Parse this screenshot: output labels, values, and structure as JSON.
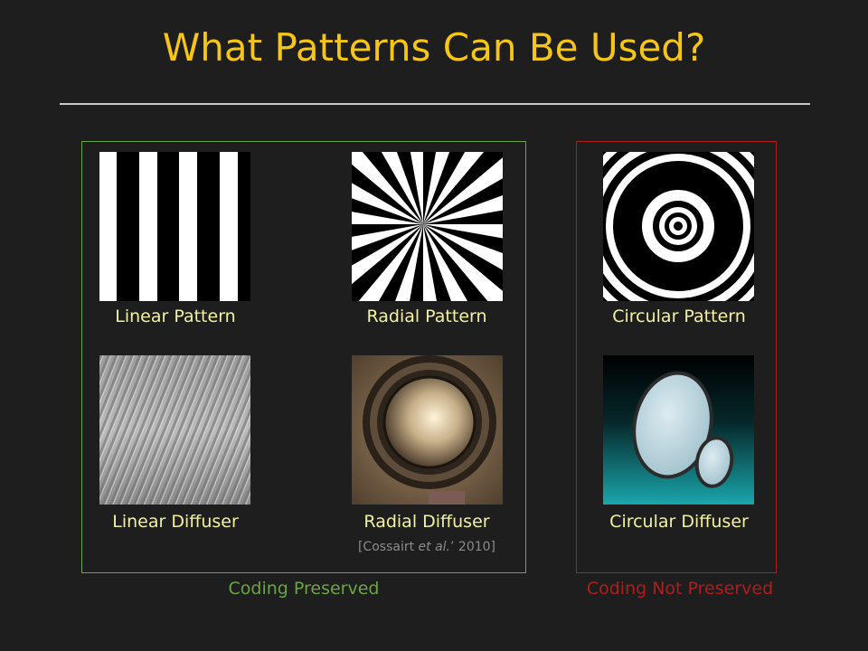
{
  "slide": {
    "title": "What Patterns Can Be Used?"
  },
  "panels": {
    "linear_pattern": "Linear Pattern",
    "radial_pattern": "Radial Pattern",
    "circular_pattern": "Circular Pattern",
    "linear_diffuser": "Linear Diffuser",
    "radial_diffuser": "Radial Diffuser",
    "circular_diffuser": "Circular Diffuser"
  },
  "citation": {
    "prefix": "[Cossairt ",
    "italic": "et al.",
    "suffix": "’ 2010]"
  },
  "groups": {
    "preserved_label": "Coding Preserved",
    "not_preserved_label": "Coding Not Preserved"
  },
  "colors": {
    "title": "#f5c518",
    "background": "#1e1e1e",
    "preserved": "#6aa642",
    "not_preserved": "#b01d1d",
    "label": "#f2f2a0"
  }
}
